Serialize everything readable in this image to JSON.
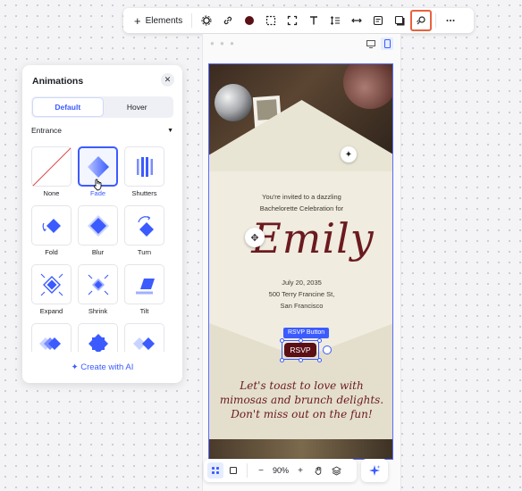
{
  "toolbar": {
    "elements_label": "Elements",
    "swatch_color": "#5a1014",
    "icons": [
      "settings-icon",
      "link-icon",
      "color-swatch",
      "dashed-select-icon",
      "crop-icon",
      "text-icon",
      "line-spacing-icon",
      "stretch-icon",
      "notes-icon",
      "shadow-icon",
      "animation-icon",
      "more-icon"
    ],
    "active_icon": "animation-icon"
  },
  "panel": {
    "title": "Animations",
    "tabs": [
      {
        "label": "Default",
        "active": true
      },
      {
        "label": "Hover",
        "active": false
      }
    ],
    "section": "Entrance",
    "tiles": [
      {
        "label": "None",
        "icon": "none-icon",
        "selected": false
      },
      {
        "label": "Fade",
        "icon": "fade-icon",
        "selected": true
      },
      {
        "label": "Shutters",
        "icon": "shutters-icon",
        "selected": false
      },
      {
        "label": "Fold",
        "icon": "fold-icon",
        "selected": false
      },
      {
        "label": "Blur",
        "icon": "blur-icon",
        "selected": false
      },
      {
        "label": "Turn",
        "icon": "turn-icon",
        "selected": false
      },
      {
        "label": "Expand",
        "icon": "expand-icon",
        "selected": false
      },
      {
        "label": "Shrink",
        "icon": "shrink-icon",
        "selected": false
      },
      {
        "label": "Tilt",
        "icon": "tilt-icon",
        "selected": false
      },
      {
        "label": "",
        "icon": "slide-icon",
        "selected": false
      },
      {
        "label": "",
        "icon": "spin-icon",
        "selected": false
      },
      {
        "label": "",
        "icon": "fly-in-icon",
        "selected": false
      }
    ],
    "create_ai": "Create with AI"
  },
  "invite": {
    "line1": "You're invited to a dazzling",
    "line2": "Bachelorette Celebration for",
    "name": "Emily",
    "date": "July 20, 2035",
    "address1": "500 Terry Francine St,",
    "address2": "San Francisco",
    "rsvp_tag": "RSVP Button",
    "rsvp": "RSVP",
    "toast1": "Let's toast to love with",
    "toast2": "mimosas and brunch delights.",
    "toast3": "Don't miss out on the fun!"
  },
  "bottom_bar": {
    "zoom": "90%",
    "zoom_out": "−",
    "zoom_in": "+"
  },
  "colors": {
    "accent": "#3b5bff",
    "highlight": "#e8623f",
    "burgundy": "#5a1014"
  }
}
